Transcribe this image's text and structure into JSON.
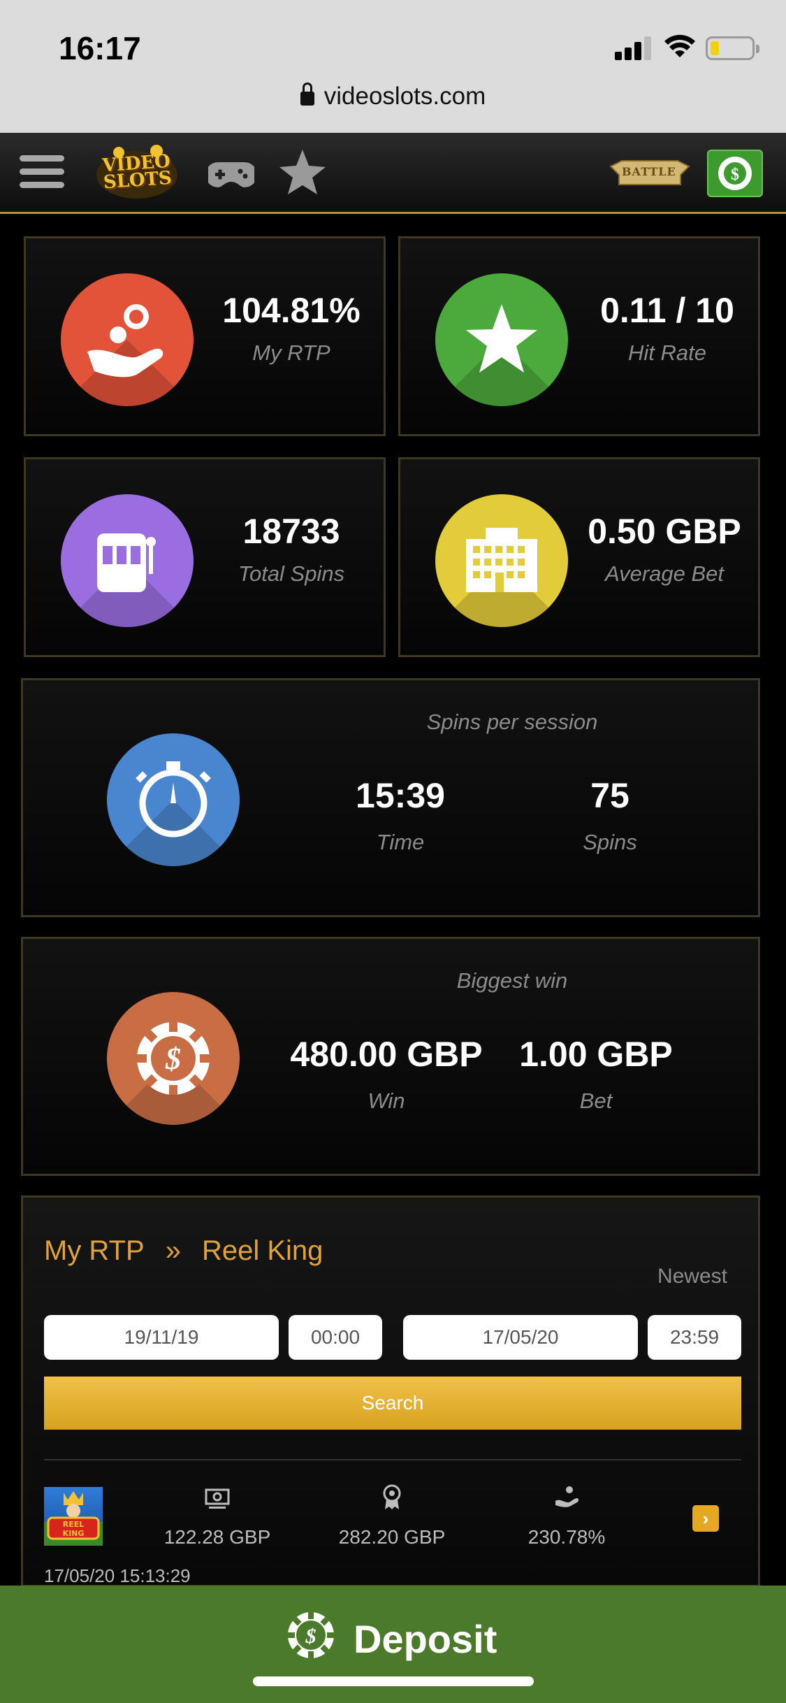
{
  "status_bar": {
    "time": "16:17",
    "url": "videoslots.com"
  },
  "nav": {
    "logo_text": "VIDEO SLOTS",
    "battle_text": "BATTLE",
    "icons": [
      "menu-icon",
      "gamepad-icon",
      "star-icon",
      "battle-of-slots-logo",
      "cashier-chip-icon"
    ]
  },
  "stats": {
    "rtp": {
      "value": "104.81%",
      "label": "My RTP"
    },
    "hit_rate": {
      "value": "0.11 / 10",
      "label": "Hit Rate"
    },
    "total_spins": {
      "value": "18733",
      "label": "Total Spins"
    },
    "average_bet": {
      "value": "0.50 GBP",
      "label": "Average Bet"
    }
  },
  "spins_per_session": {
    "title": "Spins per session",
    "time_value": "15:39",
    "time_label": "Time",
    "spins_value": "75",
    "spins_label": "Spins"
  },
  "biggest_win": {
    "title": "Biggest win",
    "win_value": "480.00 GBP",
    "win_label": "Win",
    "bet_value": "1.00 GBP",
    "bet_label": "Bet"
  },
  "rtp_history": {
    "breadcrumb_root": "My RTP",
    "breadcrumb_sep": "»",
    "breadcrumb_game": "Reel King",
    "sort_label": "Newest",
    "from_date": "19/11/19",
    "from_time": "00:00",
    "to_date": "17/05/20",
    "to_time": "23:59",
    "search_label": "Search",
    "rows": [
      {
        "game_thumb_text": "REEL KING",
        "bet_total": "122.28 GBP",
        "win_total": "282.20 GBP",
        "rtp": "230.78%",
        "datetime": "17/05/20 15:13:29"
      }
    ]
  },
  "deposit": {
    "label": "Deposit"
  },
  "colors": {
    "accent": "#e0a23c",
    "rtp_circle": "#e2533a",
    "hit_circle": "#4caa3c",
    "spins_circle": "#9a6ee0",
    "bet_circle": "#e3cc3a",
    "session_circle": "#4a86cf",
    "win_circle": "#c96e44",
    "deposit_bg": "#4a7a2a"
  }
}
